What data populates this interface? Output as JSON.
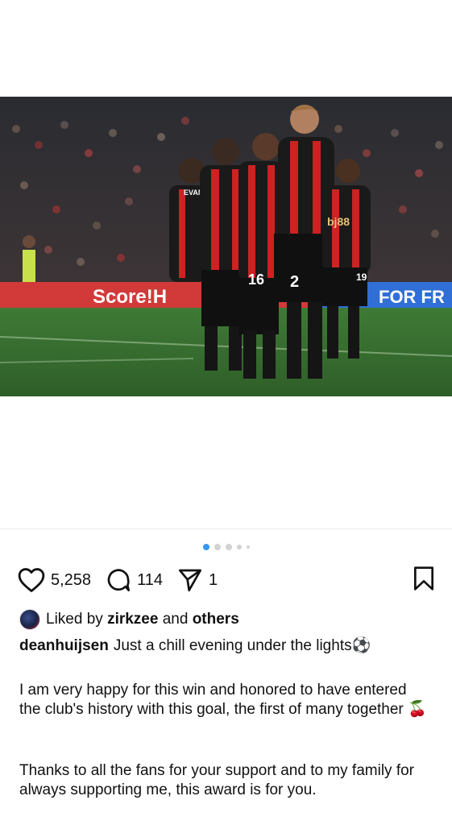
{
  "post": {
    "pagination": {
      "total": 5,
      "active": 0
    },
    "actions": {
      "likes": "5,258",
      "comments": "114",
      "shares": "1"
    },
    "liked_by": {
      "prefix": "Liked by",
      "user": "zirkzee",
      "and": "and",
      "others": "others"
    },
    "caption": {
      "username": "deanhuijsen",
      "text": "Just a chill evening under the lights⚽",
      "paragraph1": "I am very happy for this win and honored to have entered the club's history with this goal, the first of many together 🍒",
      "paragraph2": "Thanks to all the fans for your support and to my family for always supporting me, this award is for you."
    },
    "photo": {
      "board_left": "Score!H",
      "board_right": "FOR FR",
      "shirt_name": "EVANIL",
      "sponsor": "bj88",
      "numbers": [
        "16",
        "2",
        "19"
      ]
    }
  }
}
